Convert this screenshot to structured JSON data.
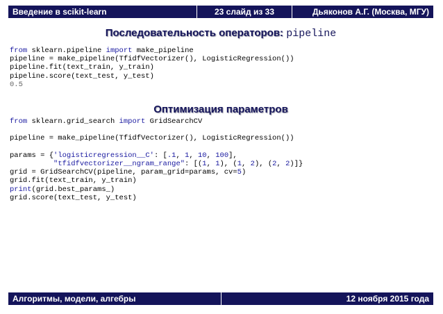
{
  "header": {
    "course": "Введение в scikit-learn",
    "slide_counter": "23 слайд из 33",
    "author": "Дьяконов А.Г. (Москва, МГУ)"
  },
  "footer": {
    "subtitle": "Алгоритмы, модели, алгебры",
    "date": "12 ноября 2015 года"
  },
  "section1": {
    "title": "Последовательность операторов:",
    "title_code": "pipeline",
    "code": [
      [
        {
          "t": "from",
          "c": "kw"
        },
        {
          "t": " sklearn.pipeline "
        },
        {
          "t": "import",
          "c": "kw"
        },
        {
          "t": " make_pipeline"
        }
      ],
      [
        {
          "t": "pipeline = make_pipeline(TfidfVectorizer(), LogisticRegression())"
        }
      ],
      [
        {
          "t": "pipeline.fit(text_train, y_train)"
        }
      ],
      [
        {
          "t": "pipeline.score(text_test, y_test)"
        }
      ],
      [
        {
          "t": "0.5",
          "c": "out"
        }
      ]
    ]
  },
  "section2": {
    "title": "Оптимизация параметров",
    "code": [
      [
        {
          "t": "from",
          "c": "kw"
        },
        {
          "t": " sklearn.grid_search "
        },
        {
          "t": "import",
          "c": "kw"
        },
        {
          "t": " GridSearchCV"
        }
      ],
      [
        {
          "t": ""
        }
      ],
      [
        {
          "t": "pipeline = make_pipeline(TfidfVectorizer(), LogisticRegression())"
        }
      ],
      [
        {
          "t": ""
        }
      ],
      [
        {
          "t": "params = {"
        },
        {
          "t": "'logisticregression__C'",
          "c": "str"
        },
        {
          "t": ": ["
        },
        {
          "t": ".1",
          "c": "num"
        },
        {
          "t": ", "
        },
        {
          "t": "1",
          "c": "num"
        },
        {
          "t": ", "
        },
        {
          "t": "10",
          "c": "num"
        },
        {
          "t": ", "
        },
        {
          "t": "100",
          "c": "num"
        },
        {
          "t": "],"
        }
      ],
      [
        {
          "t": "          "
        },
        {
          "t": "\"tfidfvectorizer__ngram_range\"",
          "c": "str"
        },
        {
          "t": ": [("
        },
        {
          "t": "1",
          "c": "num"
        },
        {
          "t": ", "
        },
        {
          "t": "1",
          "c": "num"
        },
        {
          "t": "), ("
        },
        {
          "t": "1",
          "c": "num"
        },
        {
          "t": ", "
        },
        {
          "t": "2",
          "c": "num"
        },
        {
          "t": "), ("
        },
        {
          "t": "2",
          "c": "num"
        },
        {
          "t": ", "
        },
        {
          "t": "2",
          "c": "num"
        },
        {
          "t": ")]}"
        }
      ],
      [
        {
          "t": "grid = GridSearchCV(pipeline, param_grid=params, cv="
        },
        {
          "t": "5",
          "c": "num"
        },
        {
          "t": ")"
        }
      ],
      [
        {
          "t": "grid.fit(text_train, y_train)"
        }
      ],
      [
        {
          "t": "print",
          "c": "kw"
        },
        {
          "t": "(grid.best_params_)"
        }
      ],
      [
        {
          "t": "grid.score(text_test, y_test)"
        }
      ]
    ]
  }
}
